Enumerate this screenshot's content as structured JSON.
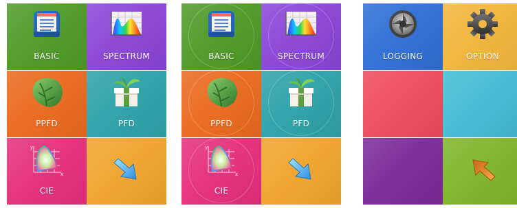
{
  "panels": [
    {
      "tiles": [
        {
          "label": "BASIC",
          "icon": "notebook-icon",
          "color": "#4f9a27"
        },
        {
          "label": "SPECTRUM",
          "icon": "spectrum-chart-icon",
          "color": "#8a45d6"
        },
        {
          "label": "PPFD",
          "icon": "leaf-icon",
          "color": "#ea6a1f"
        },
        {
          "label": "PFD",
          "icon": "plant-box-icon",
          "color": "#2ea2a8"
        },
        {
          "label": "CIE",
          "icon": "cie-chart-icon",
          "color": "#e62f7c"
        },
        {
          "label": "",
          "icon": "arrow-next-icon",
          "color": "#f0a42c"
        }
      ]
    },
    {
      "tiles": [
        {
          "label": "BASIC",
          "icon": "notebook-icon",
          "color": "#4f9a27"
        },
        {
          "label": "SPECTRUM",
          "icon": "spectrum-chart-icon",
          "color": "#8a45d6"
        },
        {
          "label": "PPFD",
          "icon": "leaf-icon",
          "color": "#ea6a1f"
        },
        {
          "label": "PFD",
          "icon": "plant-box-icon",
          "color": "#2ea2a8"
        },
        {
          "label": "CIE",
          "icon": "cie-chart-icon",
          "color": "#e62f7c"
        },
        {
          "label": "",
          "icon": "arrow-next-icon",
          "color": "#f0a42c"
        }
      ]
    },
    {
      "tiles": [
        {
          "label": "LOGGING",
          "icon": "camera-shutter-icon",
          "color": "#2f6fd6"
        },
        {
          "label": "OPTION",
          "icon": "gear-icon",
          "color": "#f2b53a"
        },
        {
          "label": "",
          "icon": "",
          "color": "#ee4b5e"
        },
        {
          "label": "",
          "icon": "",
          "color": "#43bcd3"
        },
        {
          "label": "",
          "icon": "",
          "color": "#7b2a9a"
        },
        {
          "label": "",
          "icon": "arrow-back-icon",
          "color": "#7fb52a"
        }
      ]
    }
  ]
}
